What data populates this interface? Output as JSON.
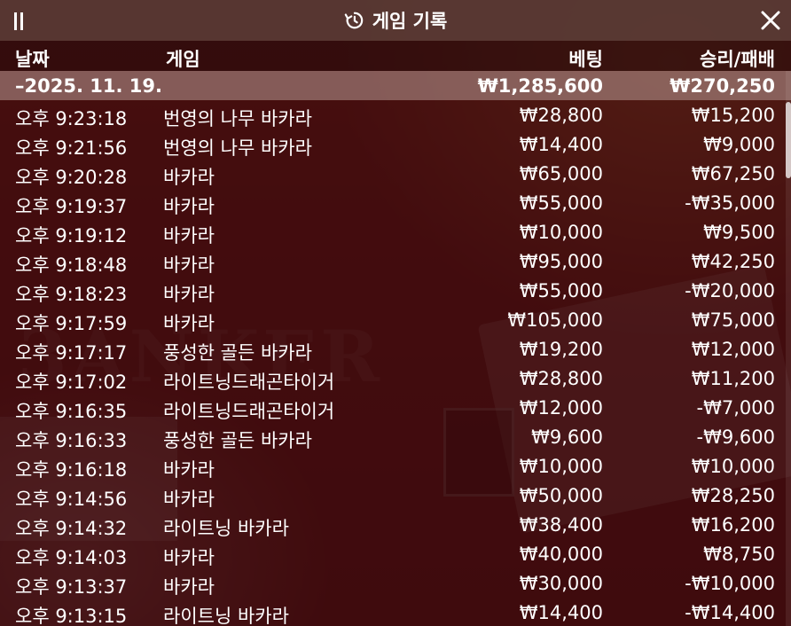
{
  "window": {
    "title": "게임 기록"
  },
  "columns": {
    "date": "날짜",
    "game": "게임",
    "bet": "베팅",
    "win_loss": "승리/패배"
  },
  "group": {
    "date": "–2025. 11. 19.",
    "bet_total": "₩1,285,600",
    "win_total": "₩270,250"
  },
  "rows": [
    {
      "time": "오후 9:23:18",
      "game": "번영의 나무 바카라",
      "bet": "₩28,800",
      "result": "₩15,200"
    },
    {
      "time": "오후 9:21:56",
      "game": "번영의 나무 바카라",
      "bet": "₩14,400",
      "result": "₩9,000"
    },
    {
      "time": "오후 9:20:28",
      "game": "바카라",
      "bet": "₩65,000",
      "result": "₩67,250"
    },
    {
      "time": "오후 9:19:37",
      "game": "바카라",
      "bet": "₩55,000",
      "result": "-₩35,000"
    },
    {
      "time": "오후 9:19:12",
      "game": "바카라",
      "bet": "₩10,000",
      "result": "₩9,500"
    },
    {
      "time": "오후 9:18:48",
      "game": "바카라",
      "bet": "₩95,000",
      "result": "₩42,250"
    },
    {
      "time": "오후 9:18:23",
      "game": "바카라",
      "bet": "₩55,000",
      "result": "-₩20,000"
    },
    {
      "time": "오후 9:17:59",
      "game": "바카라",
      "bet": "₩105,000",
      "result": "₩75,000"
    },
    {
      "time": "오후 9:17:17",
      "game": "풍성한 골든 바카라",
      "bet": "₩19,200",
      "result": "₩12,000"
    },
    {
      "time": "오후 9:17:02",
      "game": "라이트닝드래곤타이거",
      "bet": "₩28,800",
      "result": "₩11,200"
    },
    {
      "time": "오후 9:16:35",
      "game": "라이트닝드래곤타이거",
      "bet": "₩12,000",
      "result": "-₩7,000"
    },
    {
      "time": "오후 9:16:33",
      "game": "풍성한 골든 바카라",
      "bet": "₩9,600",
      "result": "-₩9,600"
    },
    {
      "time": "오후 9:16:18",
      "game": "바카라",
      "bet": "₩10,000",
      "result": "₩10,000"
    },
    {
      "time": "오후 9:14:56",
      "game": "바카라",
      "bet": "₩50,000",
      "result": "₩28,250"
    },
    {
      "time": "오후 9:14:32",
      "game": "라이트닝 바카라",
      "bet": "₩38,400",
      "result": "₩16,200"
    },
    {
      "time": "오후 9:14:03",
      "game": "바카라",
      "bet": "₩40,000",
      "result": "₩8,750"
    },
    {
      "time": "오후 9:13:37",
      "game": "바카라",
      "bet": "₩30,000",
      "result": "-₩10,000"
    },
    {
      "time": "오후 9:13:15",
      "game": "라이트닝 바카라",
      "bet": "₩14,400",
      "result": "-₩14,400"
    }
  ],
  "icons": {
    "pause": "pause-icon",
    "history": "history-icon",
    "close": "close-icon"
  },
  "colors": {
    "text": "#ffffff",
    "panel_overlay": "#3c0c0e",
    "date_row_bg": "#b99b96"
  }
}
